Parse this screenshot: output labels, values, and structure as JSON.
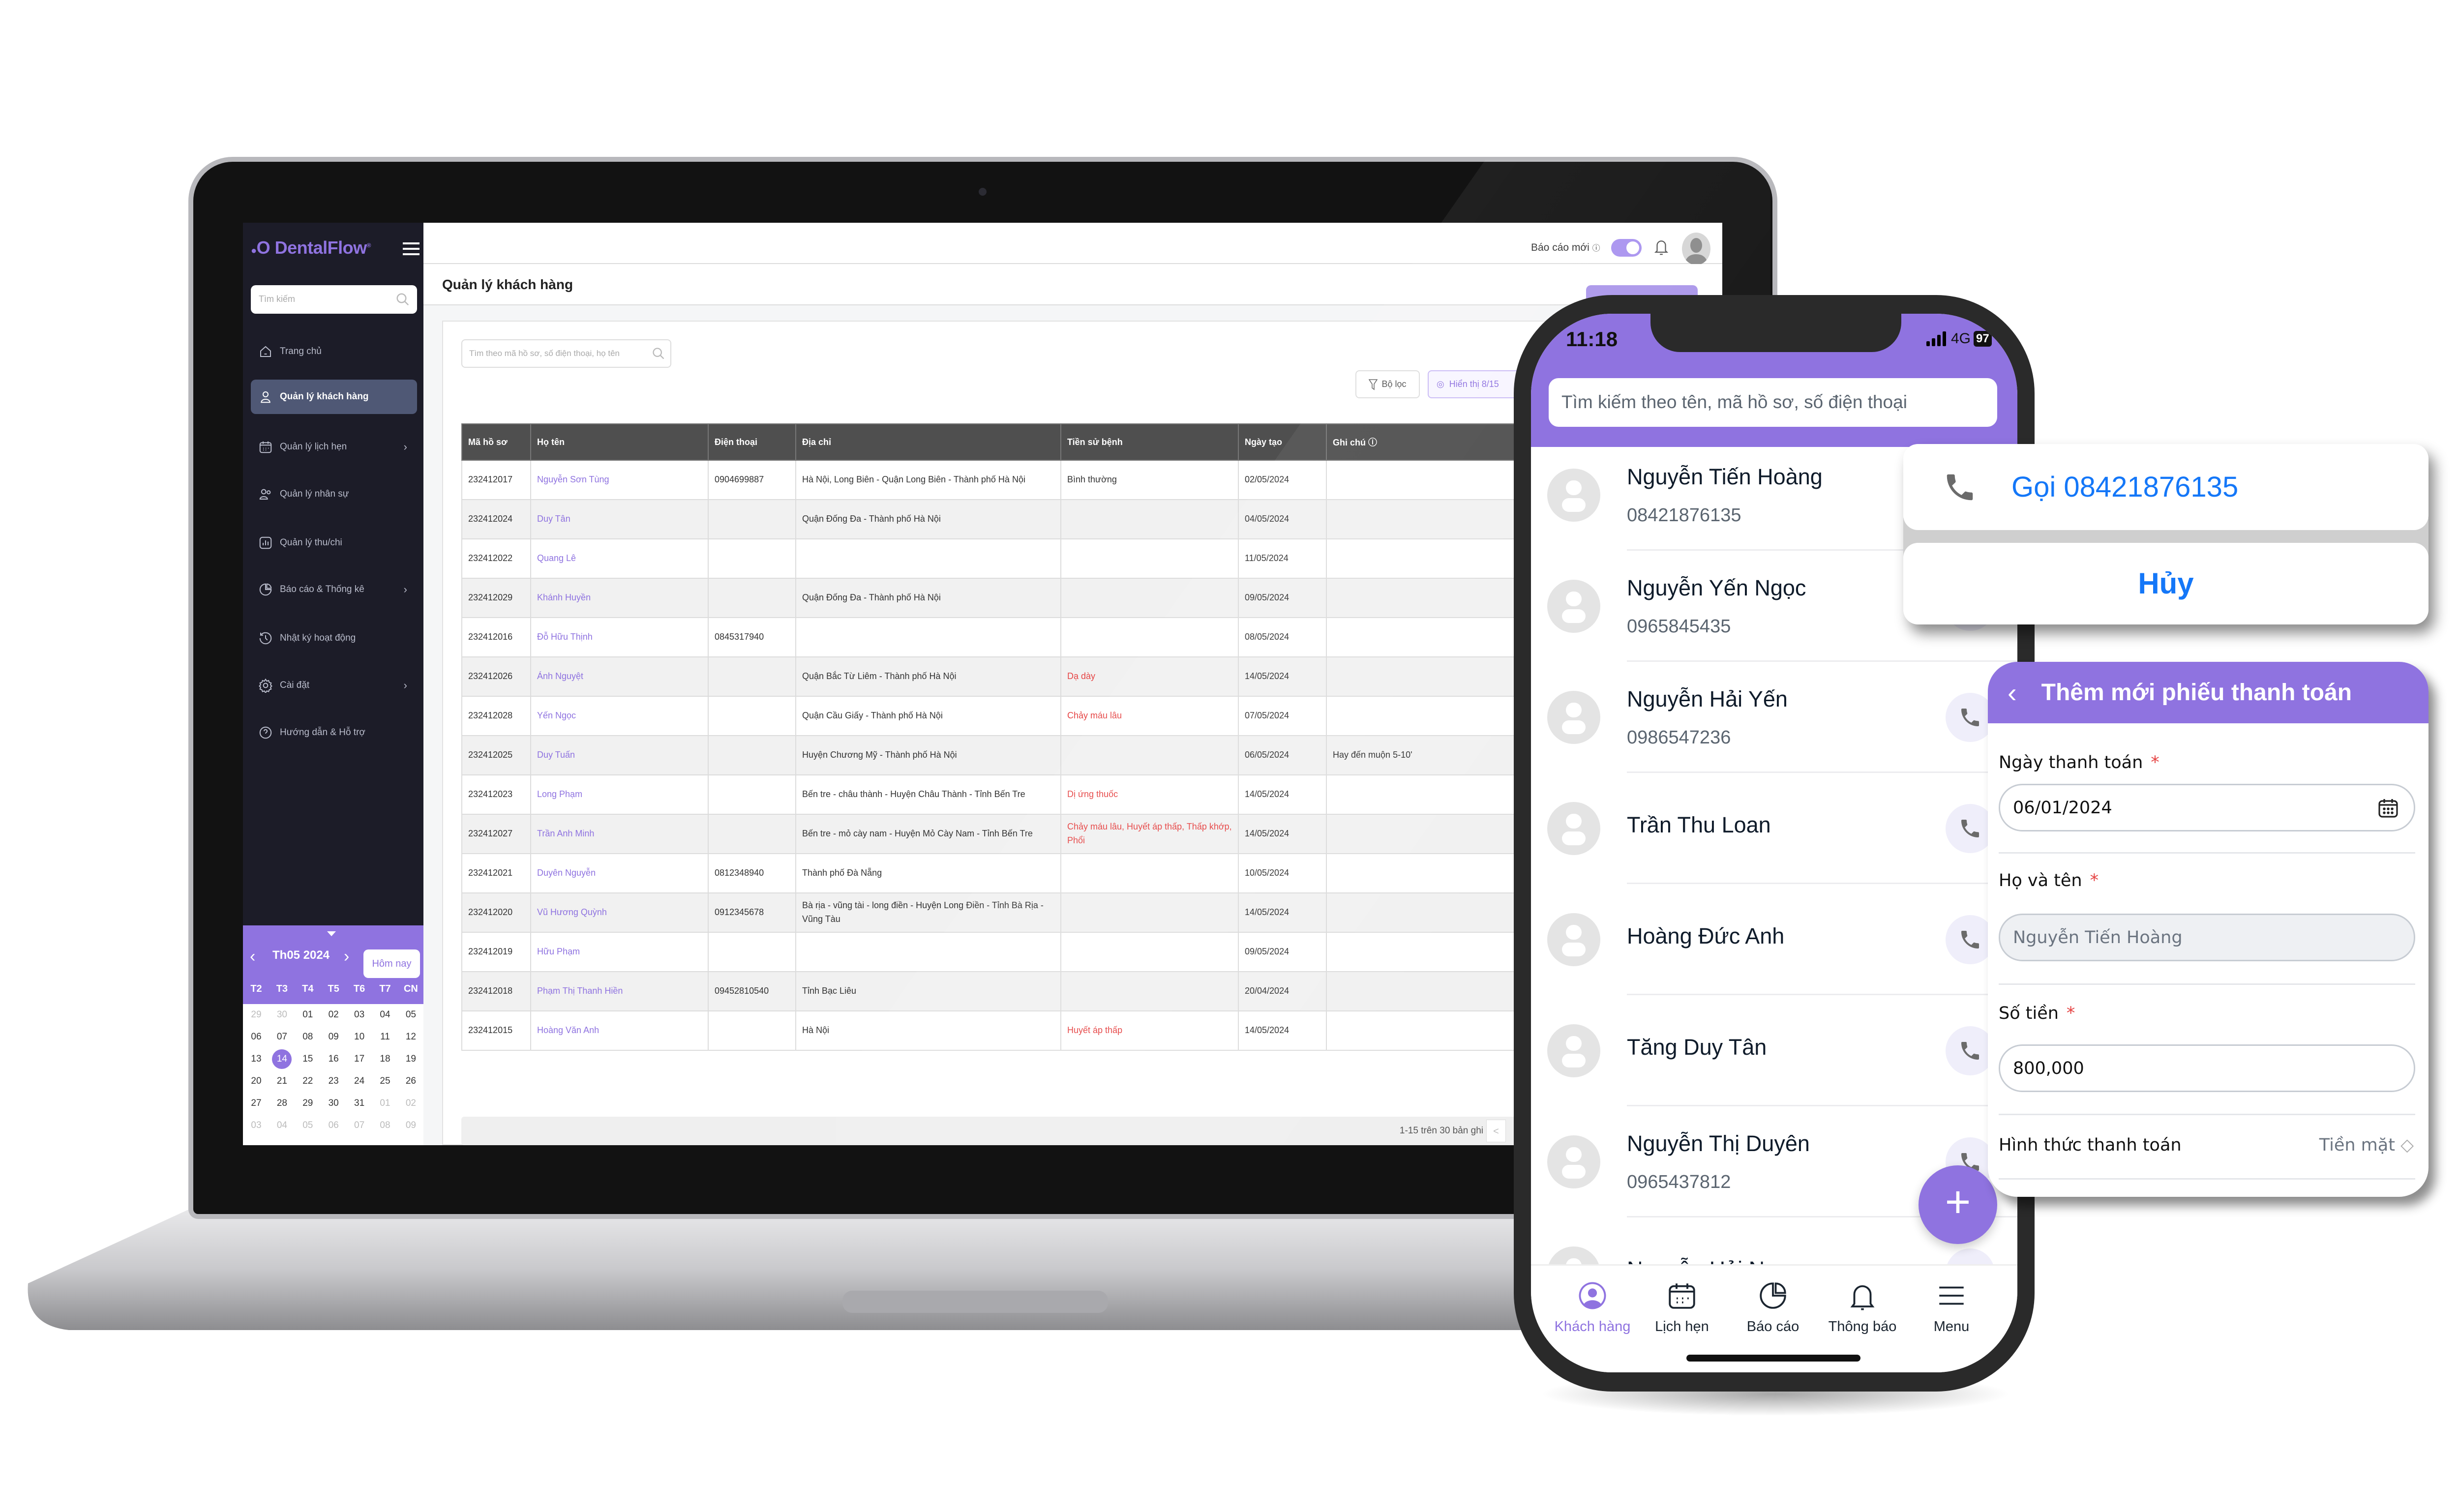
{
  "colors": {
    "brand": "#8f73e0",
    "sidebar_bg": "#1c1c28",
    "alert_text": "#e64545",
    "ios_blue": "#1477f8"
  },
  "web": {
    "logo": "DentalFlow",
    "sidebar": {
      "search_placeholder": "Tìm kiếm",
      "items": [
        {
          "label": "Trang chủ",
          "icon": "home-icon",
          "active": false,
          "has_children": false
        },
        {
          "label": "Quản lý khách hàng",
          "icon": "user-icon",
          "active": true,
          "has_children": false
        },
        {
          "label": "Quản lý lịch hẹn",
          "icon": "calendar-icon",
          "active": false,
          "has_children": true
        },
        {
          "label": "Quản lý nhân sự",
          "icon": "users-icon",
          "active": false,
          "has_children": false
        },
        {
          "label": "Quản lý thu/chi",
          "icon": "chart-icon",
          "active": false,
          "has_children": false
        },
        {
          "label": "Báo cáo & Thống kê",
          "icon": "pie-chart-icon",
          "active": false,
          "has_children": true
        },
        {
          "label": "Nhật ký hoạt động",
          "icon": "history-icon",
          "active": false,
          "has_children": false
        },
        {
          "label": "Cài đặt",
          "icon": "gear-icon",
          "active": false,
          "has_children": true
        },
        {
          "label": "Hướng dẫn & Hỗ trợ",
          "icon": "help-icon",
          "active": false,
          "has_children": false
        }
      ],
      "calendar": {
        "title": "Th05 2024",
        "today_label": "Hôm nay",
        "weekdays": [
          "T2",
          "T3",
          "T4",
          "T5",
          "T6",
          "T7",
          "CN"
        ],
        "selected": "14",
        "weeks": [
          [
            {
              "d": "29",
              "other": true
            },
            {
              "d": "30",
              "other": true
            },
            {
              "d": "01"
            },
            {
              "d": "02"
            },
            {
              "d": "03"
            },
            {
              "d": "04"
            },
            {
              "d": "05"
            }
          ],
          [
            {
              "d": "06"
            },
            {
              "d": "07"
            },
            {
              "d": "08"
            },
            {
              "d": "09"
            },
            {
              "d": "10"
            },
            {
              "d": "11"
            },
            {
              "d": "12"
            }
          ],
          [
            {
              "d": "13"
            },
            {
              "d": "14"
            },
            {
              "d": "15"
            },
            {
              "d": "16"
            },
            {
              "d": "17"
            },
            {
              "d": "18"
            },
            {
              "d": "19"
            }
          ],
          [
            {
              "d": "20"
            },
            {
              "d": "21"
            },
            {
              "d": "22"
            },
            {
              "d": "23"
            },
            {
              "d": "24"
            },
            {
              "d": "25"
            },
            {
              "d": "26"
            }
          ],
          [
            {
              "d": "27"
            },
            {
              "d": "28"
            },
            {
              "d": "29"
            },
            {
              "d": "30"
            },
            {
              "d": "31"
            },
            {
              "d": "01",
              "other": true
            },
            {
              "d": "02",
              "other": true
            }
          ],
          [
            {
              "d": "03",
              "other": true
            },
            {
              "d": "04",
              "other": true
            },
            {
              "d": "05",
              "other": true
            },
            {
              "d": "06",
              "other": true
            },
            {
              "d": "07",
              "other": true
            },
            {
              "d": "08",
              "other": true
            },
            {
              "d": "09",
              "other": true
            }
          ]
        ]
      }
    },
    "header": {
      "report_label": "Báo cáo mới",
      "report_toggle_on": true
    },
    "page_title": "Quản lý khách hàng",
    "search_placeholder": "Tìm theo mã hồ sơ, số điện thoại, họ tên",
    "filter_label": "Bộ lọc",
    "display_label": "Hiển thị 8/15",
    "table": {
      "columns": [
        "Mã hồ sơ",
        "Họ tên",
        "Điện thoại",
        "Địa chỉ",
        "Tiền sử bệnh",
        "Ngày tạo",
        "Ghi chú"
      ],
      "rows": [
        {
          "id": "232412017",
          "name": "Nguyễn Sơn Tùng",
          "phone": "0904699887",
          "address": "Hà Nội, Long Biên - Quận Long Biên - Thành phố Hà Nội",
          "history": "Bình thường",
          "history_alert": false,
          "created": "02/05/2024",
          "note": ""
        },
        {
          "id": "232412024",
          "name": "Duy Tân",
          "phone": "",
          "address": "Quận Đống Đa - Thành phố Hà Nội",
          "history": "",
          "history_alert": false,
          "created": "04/05/2024",
          "note": ""
        },
        {
          "id": "232412022",
          "name": "Quang Lê",
          "phone": "",
          "address": "",
          "history": "",
          "history_alert": false,
          "created": "11/05/2024",
          "note": ""
        },
        {
          "id": "232412029",
          "name": "Khánh Huyền",
          "phone": "",
          "address": "Quận Đống Đa - Thành phố Hà Nội",
          "history": "",
          "history_alert": false,
          "created": "09/05/2024",
          "note": ""
        },
        {
          "id": "232412016",
          "name": "Đỗ Hữu Thịnh",
          "phone": "0845317940",
          "address": "",
          "history": "",
          "history_alert": false,
          "created": "08/05/2024",
          "note": ""
        },
        {
          "id": "232412026",
          "name": "Ánh Nguyệt",
          "phone": "",
          "address": "Quận Bắc Từ Liêm - Thành phố Hà Nội",
          "history": "Dạ dày",
          "history_alert": true,
          "created": "14/05/2024",
          "note": ""
        },
        {
          "id": "232412028",
          "name": "Yến Ngọc",
          "phone": "",
          "address": "Quận Cầu Giấy - Thành phố Hà Nội",
          "history": "Chảy máu lâu",
          "history_alert": true,
          "created": "07/05/2024",
          "note": ""
        },
        {
          "id": "232412025",
          "name": "Duy Tuấn",
          "phone": "",
          "address": "Huyện Chương Mỹ - Thành phố Hà Nội",
          "history": "",
          "history_alert": false,
          "created": "06/05/2024",
          "note": "Hay đến muộn 5-10'"
        },
        {
          "id": "232412023",
          "name": "Long Phạm",
          "phone": "",
          "address": "Bến tre - châu thành - Huyện Châu Thành - Tỉnh Bến Tre",
          "history": "Dị ứng thuốc",
          "history_alert": true,
          "created": "14/05/2024",
          "note": ""
        },
        {
          "id": "232412027",
          "name": "Trần Anh Minh",
          "phone": "",
          "address": "Bến tre - mỏ cày nam - Huyện Mỏ Cày Nam - Tỉnh Bến Tre",
          "history": "Chảy máu lâu, Huyết áp thấp, Thấp khớp, Phổi",
          "history_alert": true,
          "created": "14/05/2024",
          "note": ""
        },
        {
          "id": "232412021",
          "name": "Duyên Nguyễn",
          "phone": "0812348940",
          "address": "Thành phố Đà Nẵng",
          "history": "",
          "history_alert": false,
          "created": "10/05/2024",
          "note": ""
        },
        {
          "id": "232412020",
          "name": "Vũ Hương Quỳnh",
          "phone": "0912345678",
          "address": "Bà rịa - vũng tài - long điền - Huyện Long Điền - Tỉnh Bà Rịa - Vũng Tàu",
          "history": "",
          "history_alert": false,
          "created": "14/05/2024",
          "note": ""
        },
        {
          "id": "232412019",
          "name": "Hữu Phạm",
          "phone": "",
          "address": "",
          "history": "",
          "history_alert": false,
          "created": "09/05/2024",
          "note": ""
        },
        {
          "id": "232412018",
          "name": "Phạm Thị Thanh Hiền",
          "phone": "09452810540",
          "address": "Tỉnh Bạc Liêu",
          "history": "",
          "history_alert": false,
          "created": "20/04/2024",
          "note": ""
        },
        {
          "id": "232412015",
          "name": "Hoàng Văn Anh",
          "phone": "",
          "address": "Hà Nội",
          "history": "Huyết áp thấp",
          "history_alert": true,
          "created": "14/05/2024",
          "note": ""
        }
      ]
    },
    "pagination": {
      "summary": "1-15 trên 30 bản ghi",
      "prev_icon": "chevron-left-icon"
    }
  },
  "mobile": {
    "status": {
      "time": "11:18",
      "network": "4G",
      "battery": "97"
    },
    "search_placeholder": "Tìm kiếm theo tên, mã hồ sơ, số điện thoại",
    "contacts": [
      {
        "name": "Nguyễn Tiến Hoàng",
        "phone": "08421876135"
      },
      {
        "name": "Nguyễn Yến Ngọc",
        "phone": "0965845435"
      },
      {
        "name": "Nguyễn Hải Yến",
        "phone": "0986547236"
      },
      {
        "name": "Trần Thu Loan",
        "phone": ""
      },
      {
        "name": "Hoàng Đức Anh",
        "phone": ""
      },
      {
        "name": "Tăng Duy Tân",
        "phone": ""
      },
      {
        "name": "Nguyễn Thị Duyên",
        "phone": "0965437812"
      },
      {
        "name": "Nguyễn Hải Nam",
        "phone": ""
      }
    ],
    "fab_icon": "plus-icon",
    "nav": [
      {
        "label": "Khách hàng",
        "icon": "user-circle-icon",
        "active": true
      },
      {
        "label": "Lịch hẹn",
        "icon": "calendar-icon",
        "active": false
      },
      {
        "label": "Báo cáo",
        "icon": "pie-chart-icon",
        "active": false
      },
      {
        "label": "Thông báo",
        "icon": "bell-icon",
        "active": false
      },
      {
        "label": "Menu",
        "icon": "menu-icon",
        "active": false
      }
    ],
    "action_sheet": {
      "call_label": "Gọi 08421876135",
      "cancel_label": "Hủy"
    },
    "payment_form": {
      "title": "Thêm mới phiếu thanh toán",
      "date_label": "Ngày thanh toán",
      "date_value": "06/01/2024",
      "name_label": "Họ và tên",
      "name_value": "Nguyễn Tiến Hoàng",
      "amount_label": "Số tiền",
      "amount_value": "800,000",
      "method_label": "Hình thức thanh toán",
      "method_value": "Tiền mặt",
      "required_mark": "*"
    }
  }
}
